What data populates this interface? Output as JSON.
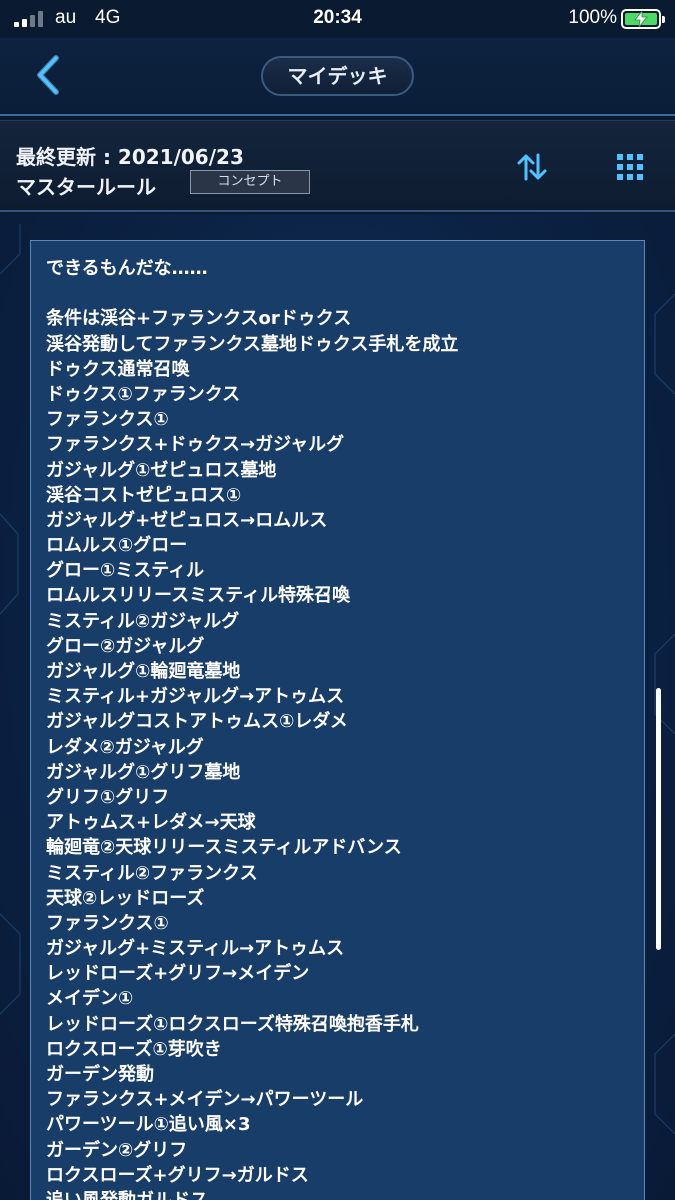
{
  "status_bar": {
    "carrier": "au",
    "network": "4G",
    "time": "20:34",
    "battery_percent": "100%",
    "battery_color": "#4cd964"
  },
  "header": {
    "title": "マイデッキ",
    "back_icon": "chevron-left-icon"
  },
  "info": {
    "last_updated": "最終更新 : 2021/06/23",
    "rule": "マスタールール",
    "badge": "コンセプト",
    "sort_icon": "sort-arrows-icon",
    "grid_icon": "grid-icon"
  },
  "deck_text": {
    "lines": [
      "できるもんだな……",
      "",
      "条件は渓谷+ファランクスorドゥクス",
      "渓谷発動してファランクス墓地ドゥクス手札を成立",
      "ドゥクス通常召喚",
      "ドゥクス①ファランクス",
      "ファランクス①",
      "ファランクス+ドゥクス→ガジャルグ",
      "ガジャルグ①ゼピュロス墓地",
      "渓谷コストゼピュロス①",
      "ガジャルグ+ゼピュロス→ロムルス",
      "ロムルス①グロー",
      "グロー①ミスティル",
      "ロムルスリリースミスティル特殊召喚",
      "ミスティル②ガジャルグ",
      "グロー②ガジャルグ",
      "ガジャルグ①輪廻竜墓地",
      "ミスティル+ガジャルグ→アトゥムス",
      "ガジャルグコストアトゥムス①レダメ",
      "レダメ②ガジャルグ",
      "ガジャルグ①グリフ墓地",
      "グリフ①グリフ",
      "アトゥムス+レダメ→天球",
      "輪廻竜②天球リリースミスティルアドバンス",
      "ミスティル②ファランクス",
      "天球②レッドローズ",
      "ファランクス①",
      "ガジャルグ+ミスティル→アトゥムス",
      "レッドローズ+グリフ→メイデン",
      "メイデン①",
      "レッドローズ①ロクスローズ特殊召喚抱香手札",
      "ロクスローズ①芽吹き",
      "ガーデン発動",
      "ファランクス+メイデン→パワーツール",
      "パワーツール①追い風×3",
      "ガーデン②グリフ",
      "ロクスローズ+グリフ→ガルドス",
      "追い風発動ガルドス"
    ]
  },
  "colors": {
    "background": "#0a1a30",
    "panel": "#183d68",
    "panel_border": "#5d88b8",
    "accent": "#4fc3ff"
  }
}
